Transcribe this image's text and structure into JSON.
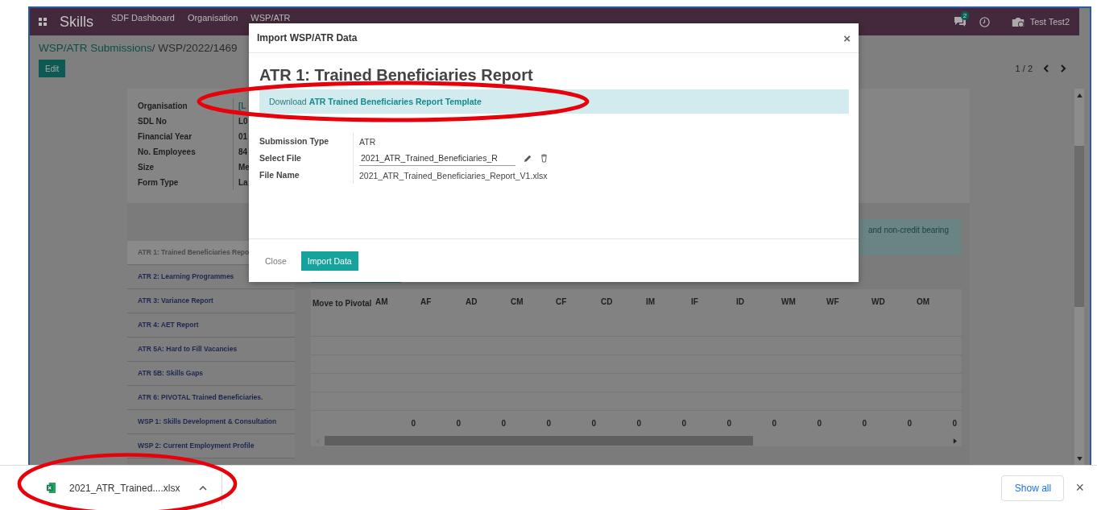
{
  "navbar": {
    "app_title": "Skills",
    "menu": [
      "SDF Dashboard",
      "Organisation",
      "WSP/ATR"
    ],
    "chat_badge": "2",
    "user": "Test Test2"
  },
  "breadcrumb": {
    "parent": "WSP/ATR Submissions",
    "current": "/ WSP/2022/1469"
  },
  "edit_button": "Edit",
  "pager": "1 / 2",
  "form_fields": [
    {
      "label": "Organisation",
      "value": "[L",
      "kind": "link"
    },
    {
      "label": "SDL No",
      "value": "L0",
      "kind": "text"
    },
    {
      "label": "Financial Year",
      "value": "01",
      "kind": "text"
    },
    {
      "label": "No. Employees",
      "value": "84",
      "kind": "text"
    },
    {
      "label": "Size",
      "value": "Me",
      "kind": "text"
    },
    {
      "label": "Form Type",
      "value": "La",
      "kind": "text"
    }
  ],
  "notebook": {
    "tabs": [
      {
        "label": "ATR 1: Trained Beneficiaries Repo",
        "selected": true
      },
      {
        "label": "ATR 2: Learning Programmes",
        "selected": false
      },
      {
        "label": "ATR 3: Variance Report",
        "selected": false
      },
      {
        "label": "ATR 4: AET Report",
        "selected": false
      },
      {
        "label": "ATR 5A: Hard to Fill Vacancies",
        "selected": false
      },
      {
        "label": "ATR 5B: Skills Gaps",
        "selected": false
      },
      {
        "label": "ATR 6: PIVOTAL Trained Beneficiaries.",
        "selected": false
      },
      {
        "label": "WSP 1: Skills Development & Consultation",
        "selected": false
      },
      {
        "label": "WSP 2: Current Employment Profile",
        "selected": false
      }
    ],
    "alert": "and non-credit bearing",
    "table": {
      "columns": [
        "Move to Pivotal",
        "AM",
        "AF",
        "AD",
        "CM",
        "CF",
        "CD",
        "IM",
        "IF",
        "ID",
        "WM",
        "WF",
        "WD",
        "OM"
      ],
      "totals": [
        "0",
        "0",
        "0",
        "0",
        "0",
        "0",
        "0",
        "0",
        "0",
        "0",
        "0",
        "0",
        "0"
      ]
    }
  },
  "modal": {
    "title": "Import WSP/ATR Data",
    "close": "×",
    "heading": "ATR 1: Trained Beneficiaries Report",
    "alert_text": "Download",
    "alert_link": "ATR Trained Beneficiaries Report Template",
    "fields": [
      {
        "label": "Submission Type",
        "value": "ATR",
        "kind": "text"
      },
      {
        "label": "Select File",
        "value": "2021_ATR_Trained_Beneficiaries_R",
        "kind": "file"
      },
      {
        "label": "File Name",
        "value": "2021_ATR_Trained_Beneficiaries_Report_V1.xlsx",
        "kind": "text"
      }
    ],
    "buttons": [
      "Close",
      "Import Data"
    ]
  },
  "download_bar": {
    "file": "2021_ATR_Trained....xlsx",
    "show_all": "Show all",
    "close": "×"
  }
}
